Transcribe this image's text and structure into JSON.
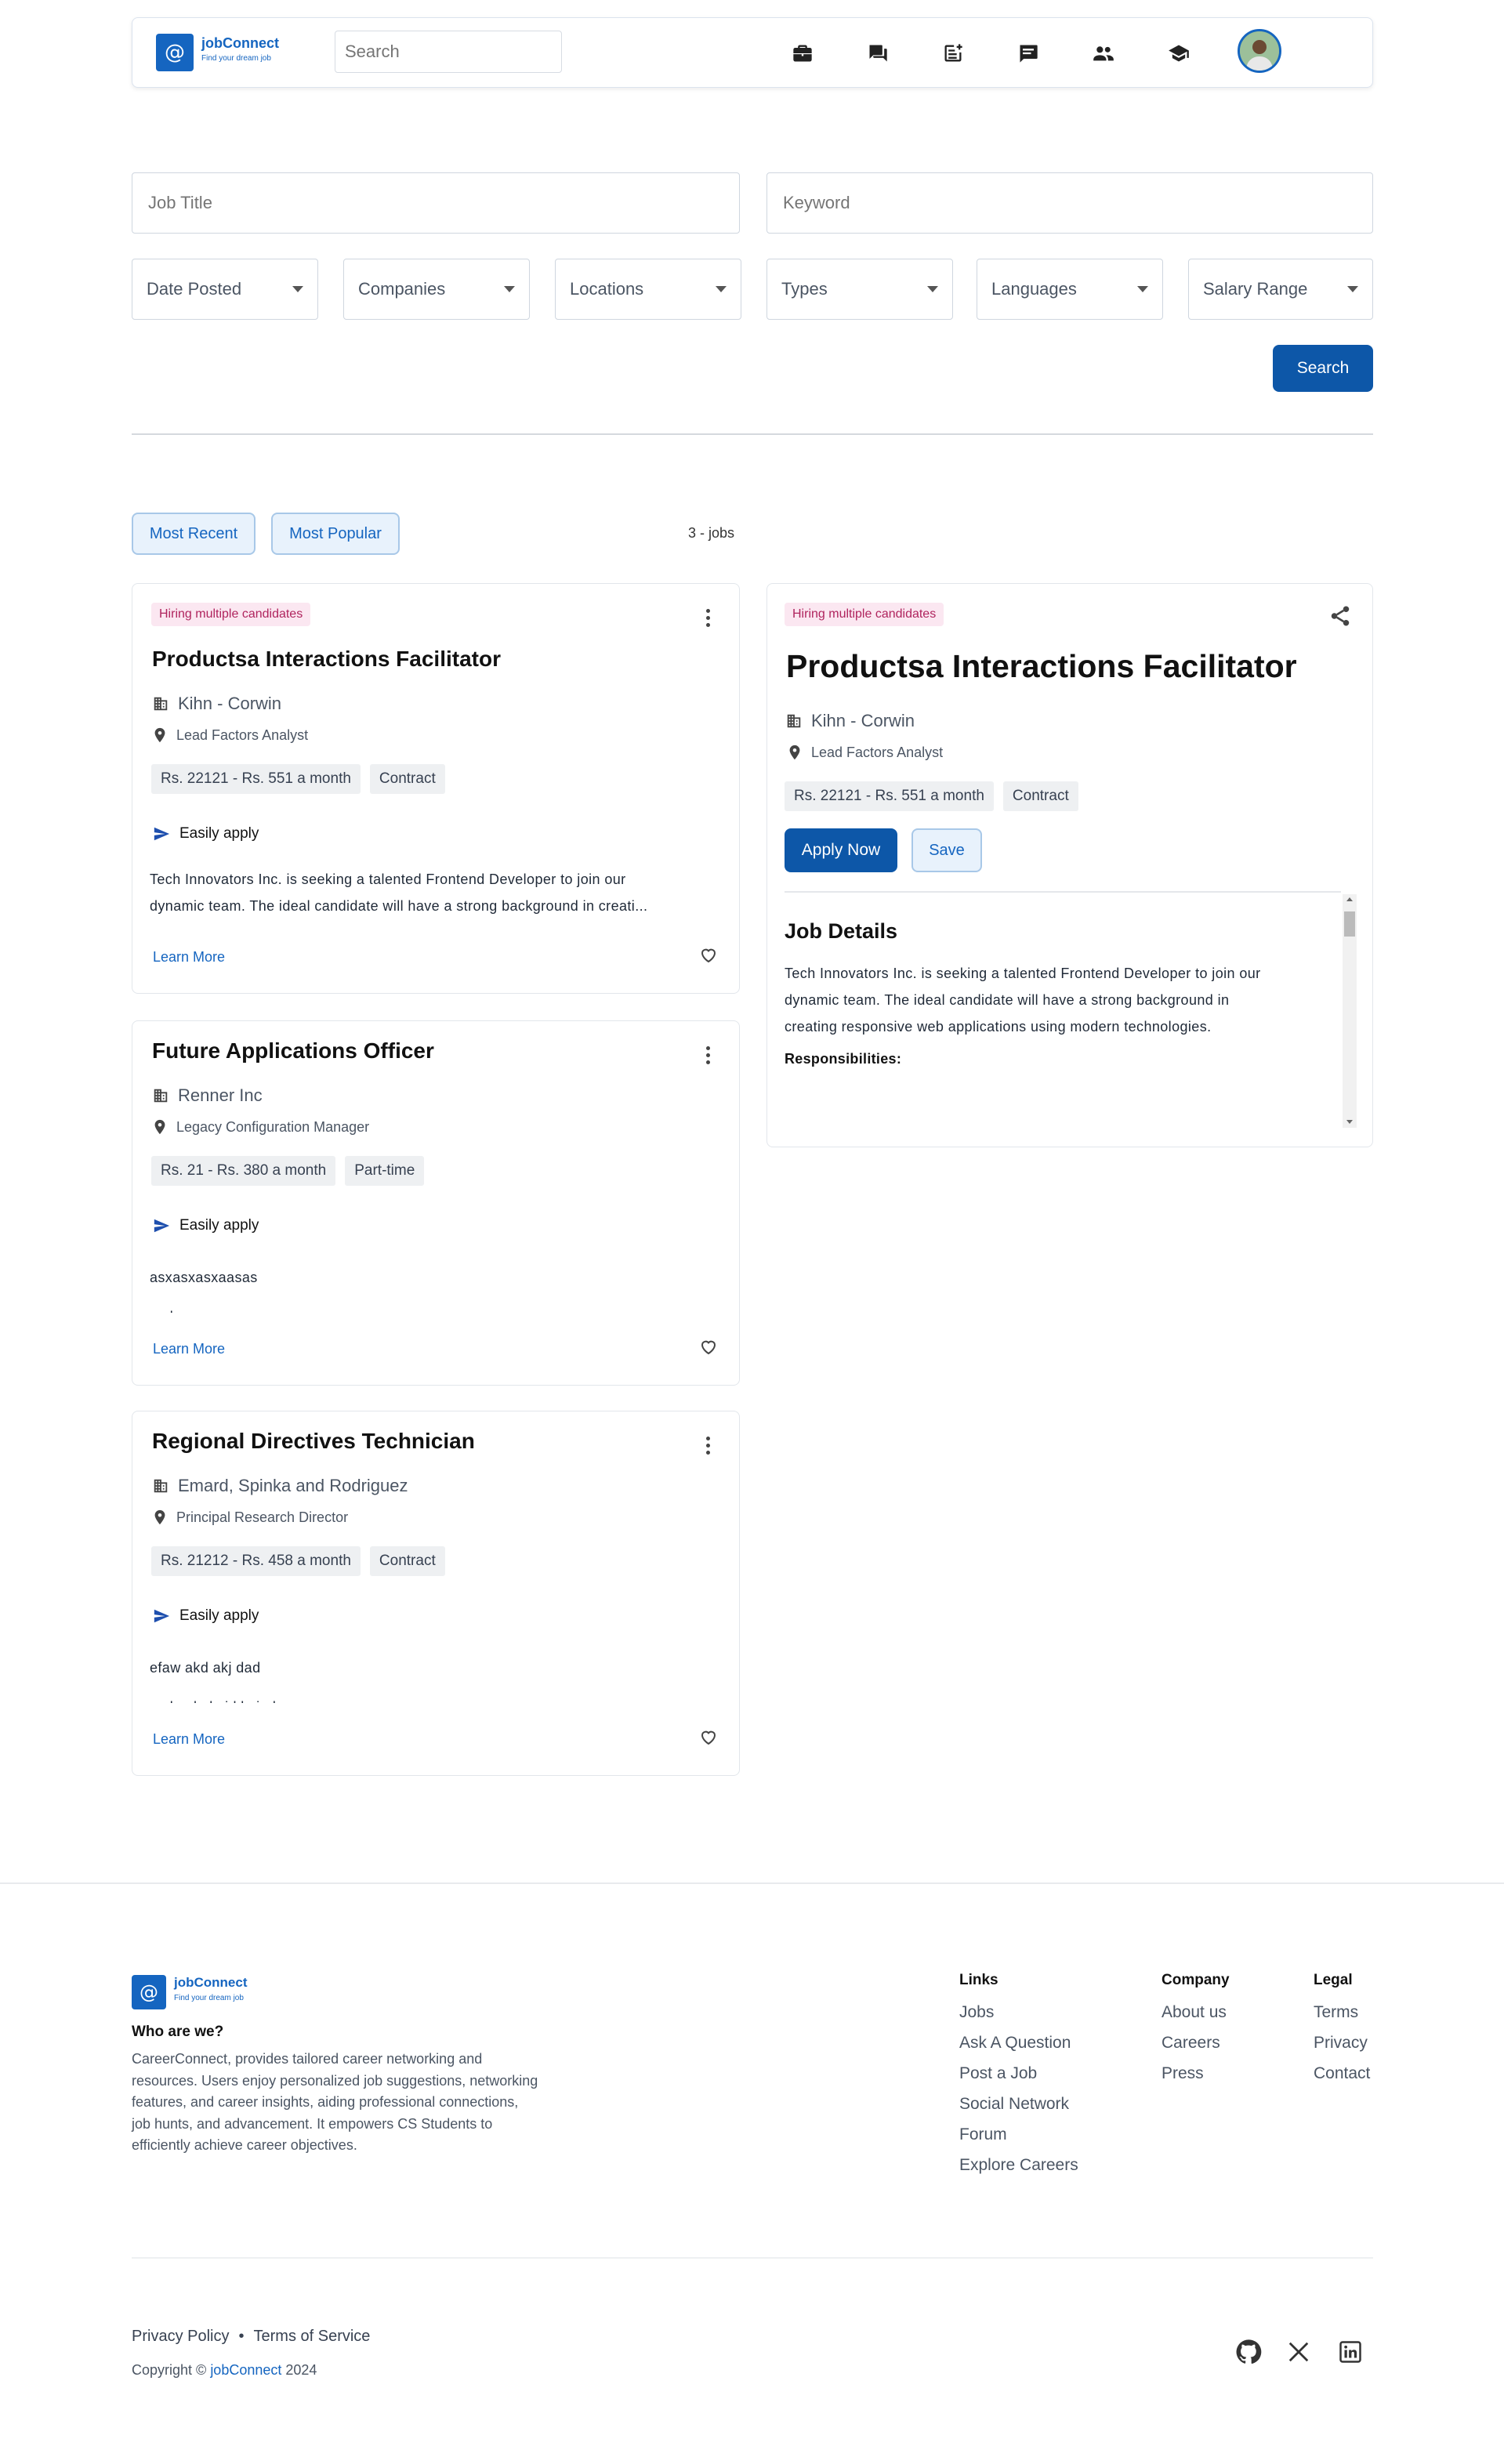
{
  "nav": {
    "logo_mark": "@",
    "logo_name": "jobConnect",
    "logo_tagline": "Find your dream job",
    "search_placeholder": "Search",
    "icons": [
      "briefcase-icon",
      "forum-icon",
      "post-add-icon",
      "chat-icon",
      "people-icon",
      "school-icon",
      "avatar",
      "dark-mode-icon"
    ]
  },
  "filters": {
    "job_title_placeholder": "Job Title",
    "keyword_placeholder": "Keyword",
    "selects": [
      "Date Posted",
      "Companies",
      "Locations",
      "Types",
      "Languages",
      "Salary Range"
    ],
    "search_label": "Search"
  },
  "sort": {
    "most_recent": "Most Recent",
    "most_popular": "Most Popular",
    "count_text": "3 - jobs"
  },
  "jobs": [
    {
      "badge": "Hiring multiple candidates",
      "title": "Productsa Interactions Facilitator",
      "company": "Kihn - Corwin",
      "location": "Lead Factors Analyst",
      "salary": "Rs. 22121 - Rs. 551 a month",
      "type": "Contract",
      "easy_apply": "Easily apply",
      "desc_line1": "Tech Innovators Inc. is seeking a talented Frontend Developer to join our",
      "desc_line2": "dynamic team. The ideal candidate will have a strong background in creati...",
      "learn_more": "Learn More"
    },
    {
      "badge": "",
      "title": "Future Applications Officer",
      "company": "Renner Inc",
      "location": "Legacy Configuration Manager",
      "salary": "Rs. 21 - Rs. 380 a month",
      "type": "Part-time",
      "easy_apply": "Easily apply",
      "desc_line1": "asxasxasxaasas",
      "desc_line2": "asdas",
      "learn_more": "Learn More"
    },
    {
      "badge": "",
      "title": "Regional Directives Technician",
      "company": "Emard, Spinka and Rodriguez",
      "location": "Principal Research Director",
      "salary": "Rs. 21212 - Rs. 458 a month",
      "type": "Contract",
      "easy_apply": "Easily apply",
      "desc_line1": "efaw akd akj dad",
      "desc_line2": "asdasd akaid kaiad",
      "learn_more": "Learn More"
    }
  ],
  "detail": {
    "badge": "Hiring multiple candidates",
    "title": "Productsa Interactions Facilitator",
    "company": "Kihn - Corwin",
    "location": "Lead Factors Analyst",
    "salary": "Rs. 22121 - Rs. 551 a month",
    "type": "Contract",
    "apply_label": "Apply Now",
    "save_label": "Save",
    "section_title": "Job Details",
    "desc_line1": "Tech Innovators Inc. is seeking a talented Frontend Developer to join our",
    "desc_line2": "dynamic team. The ideal candidate will have a strong background in",
    "desc_line3": "creating responsive web applications using modern technologies.",
    "responsibilities": "Responsibilities:"
  },
  "footer": {
    "who_title": "Who are we?",
    "who_lines": [
      "CareerConnect, provides tailored career networking and",
      "resources. Users enjoy personalized job suggestions, networking",
      "features, and career insights, aiding professional connections,",
      "job hunts, and advancement. It empowers CS Students to",
      "efficiently achieve career objectives."
    ],
    "links_title": "Links",
    "links": [
      "Jobs",
      "Ask A Question",
      "Post a Job",
      "Social Network",
      "Forum",
      "Explore Careers"
    ],
    "company_title": "Company",
    "company_links": [
      "About us",
      "Careers",
      "Press"
    ],
    "legal_title": "Legal",
    "legal_links": [
      "Terms",
      "Privacy",
      "Contact"
    ],
    "privacy": "Privacy Policy",
    "dot": "•",
    "terms": "Terms of Service",
    "copyright_prefix": "Copyright © ",
    "copyright_brand": "jobConnect",
    "copyright_year": " 2024"
  },
  "colors": {
    "primary": "#0d57a8",
    "brand": "#1565c0",
    "badge_bg": "#fbe7f1",
    "badge_text": "#b0245e"
  }
}
